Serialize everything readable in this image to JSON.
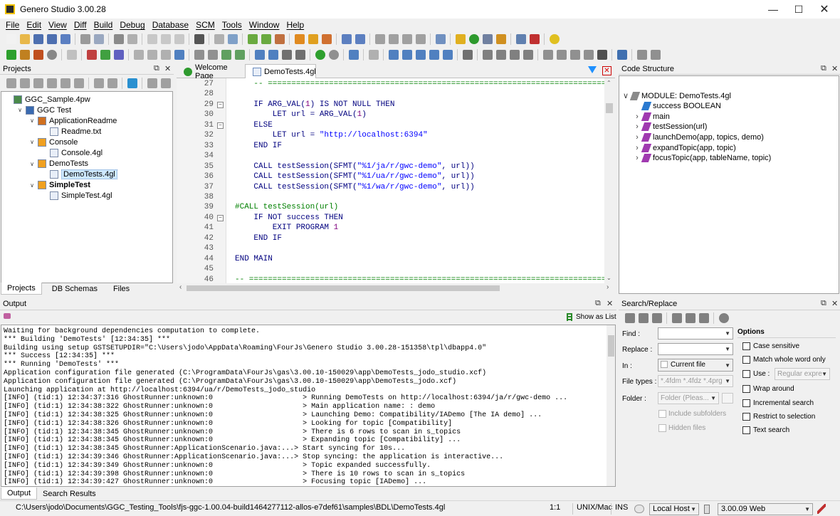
{
  "window": {
    "title": "Genero Studio 3.00.28"
  },
  "menu": [
    "File",
    "Edit",
    "View",
    "Diff",
    "Build",
    "Debug",
    "Database",
    "SCM",
    "Tools",
    "Window",
    "Help"
  ],
  "projects": {
    "title": "Projects",
    "tree": [
      {
        "label": "GGC_Sample.4pw",
        "depth": 0,
        "icon": "workspace-icon",
        "expand": ""
      },
      {
        "label": "GGC Test",
        "depth": 1,
        "icon": "project-icon",
        "expand": "v"
      },
      {
        "label": "ApplicationReadme",
        "depth": 2,
        "icon": "application-icon",
        "expand": "v"
      },
      {
        "label": "Readme.txt",
        "depth": 3,
        "icon": "text-file-icon",
        "expand": ""
      },
      {
        "label": "Console",
        "depth": 2,
        "icon": "module-group-icon",
        "expand": "v"
      },
      {
        "label": "Console.4gl",
        "depth": 3,
        "icon": "4gl-file-icon",
        "expand": ""
      },
      {
        "label": "DemoTests",
        "depth": 2,
        "icon": "module-group-icon",
        "expand": "v"
      },
      {
        "label": "DemoTests.4gl",
        "depth": 3,
        "icon": "4gl-file-icon",
        "expand": "",
        "selected": true
      },
      {
        "label": "SimpleTest",
        "depth": 2,
        "icon": "module-group-icon",
        "expand": "v",
        "bold": true
      },
      {
        "label": "SimpleTest.4gl",
        "depth": 3,
        "icon": "4gl-file-icon",
        "expand": ""
      }
    ],
    "tabs": [
      "Projects",
      "DB Schemas",
      "Files"
    ]
  },
  "editor": {
    "tabs": [
      "Welcome Page",
      "DemoTests.4gl"
    ],
    "lines": [
      {
        "n": "27",
        "html": "<span class=\"com\">    -- ============================================================================</span>"
      },
      {
        "n": "28",
        "html": ""
      },
      {
        "n": "29",
        "html": "    IF ARG_VAL(<span class=\"num\">1</span>) IS NOT NULL THEN",
        "fold": "-"
      },
      {
        "n": "30",
        "html": "        LET url = ARG_VAL(<span class=\"num\">1</span>)"
      },
      {
        "n": "31",
        "html": "    ELSE",
        "fold": "-"
      },
      {
        "n": "32",
        "html": "        LET url = <span class=\"str\">\"http://localhost:6394\"</span>"
      },
      {
        "n": "33",
        "html": "    END IF"
      },
      {
        "n": "34",
        "html": ""
      },
      {
        "n": "35",
        "html": "    CALL testSession(SFMT(<span class=\"str\">\"%1/ja/r/gwc-demo\"</span>, url))"
      },
      {
        "n": "36",
        "html": "    CALL testSession(SFMT(<span class=\"str\">\"%1/ua/r/gwc-demo\"</span>, url))"
      },
      {
        "n": "37",
        "html": "    CALL testSession(SFMT(<span class=\"str\">\"%1/wa/r/gwc-demo\"</span>, url))"
      },
      {
        "n": "38",
        "html": ""
      },
      {
        "n": "39",
        "html": "<span class=\"com\">#CALL testSession(url)</span>"
      },
      {
        "n": "40",
        "html": "    IF NOT success THEN",
        "fold": "-"
      },
      {
        "n": "41",
        "html": "        EXIT PROGRAM <span class=\"num\">1</span>"
      },
      {
        "n": "42",
        "html": "    END IF"
      },
      {
        "n": "43",
        "html": ""
      },
      {
        "n": "44",
        "html": "END MAIN"
      },
      {
        "n": "45",
        "html": ""
      },
      {
        "n": "46",
        "html": "<span class=\"com\">-- ============================================================================</span>"
      }
    ]
  },
  "code_structure": {
    "title": "Code Structure",
    "items": [
      {
        "label": "MODULE: DemoTests.4gl",
        "depth": 0,
        "expand": "v",
        "icon": "module-icon"
      },
      {
        "label": "success BOOLEAN",
        "depth": 1,
        "expand": "",
        "icon": "variable-icon"
      },
      {
        "label": "main",
        "depth": 1,
        "expand": ">",
        "icon": "function-icon"
      },
      {
        "label": "testSession(url)",
        "depth": 1,
        "expand": ">",
        "icon": "function-icon"
      },
      {
        "label": "launchDemo(app, topics, demo)",
        "depth": 1,
        "expand": ">",
        "icon": "function-icon"
      },
      {
        "label": "expandTopic(app, topic)",
        "depth": 1,
        "expand": ">",
        "icon": "function-icon"
      },
      {
        "label": "focusTopic(app, tableName, topic)",
        "depth": 1,
        "expand": ">",
        "icon": "function-icon"
      }
    ]
  },
  "output": {
    "title": "Output",
    "show_as_list": "Show as List",
    "lines": [
      "Waiting for background dependencies computation to complete.",
      "*** Building 'DemoTests' [12:34:35] ***",
      "Building using setup GSTSETUPDIR=\"C:\\Users\\jodo\\AppData\\Roaming\\FourJs\\Genero Studio 3.00.28-151358\\tpl\\dbapp4.0\"",
      "*** Success [12:34:35] ***",
      "*** Running 'DemoTests' ***",
      "Application configuration file generated (C:\\ProgramData\\FourJs\\gas\\3.00.10-150029\\app\\DemoTests_jodo_studio.xcf)",
      "Application configuration file generated (C:\\ProgramData\\FourJs\\gas\\3.00.10-150029\\app\\DemoTests_jodo.xcf)",
      "Launching application at http://localhost:6394/ua/r/DemoTests_jodo_studio",
      "[INFO] (tid:1) 12:34:37:316 GhostRunner:unknown:0                     > Running DemoTests on http://localhost:6394/ja/r/gwc-demo ...",
      "[INFO] (tid:1) 12:34:38:322 GhostRunner:unknown:0                     > Main application name: : demo",
      "[INFO] (tid:1) 12:34:38:325 GhostRunner:unknown:0                     > Launching Demo: Compatibility/IADemo [The IA demo] ...",
      "[INFO] (tid:1) 12:34:38:326 GhostRunner:unknown:0                     > Looking for topic [Compatibility]",
      "[INFO] (tid:1) 12:34:38:345 GhostRunner:unknown:0                     > There is 6 rows to scan in s_topics",
      "[INFO] (tid:1) 12:34:38:345 GhostRunner:unknown:0                     > Expanding topic [Compatibility] ...",
      "[INFO] (tid:1) 12:34:38:345 GhostRunner:ApplicationScenario.java:...> Start syncing for 10s...",
      "[INFO] (tid:1) 12:34:39:346 GhostRunner:ApplicationScenario.java:...> Stop syncing: the application is interactive...",
      "[INFO] (tid:1) 12:34:39:349 GhostRunner:unknown:0                     > Topic expanded successfully.",
      "[INFO] (tid:1) 12:34:39:398 GhostRunner:unknown:0                     > There is 10 rows to scan in s_topics",
      "[INFO] (tid:1) 12:34:39:427 GhostRunner:unknown:0                     > Focusing topic [IADemo] ..."
    ],
    "tabs": [
      "Output",
      "Search Results"
    ]
  },
  "search": {
    "title": "Search/Replace",
    "find_label": "Find :",
    "replace_label": "Replace :",
    "in_label": "In :",
    "in_value": "Current file",
    "file_types_label": "File types :",
    "file_types_value": "*.4fdm *.4fdz *.4prg",
    "folder_label": "Folder :",
    "folder_placeholder": "Folder (Pleas...",
    "include_subfolders": "Include subfolders",
    "hidden_files": "Hidden files",
    "options_title": "Options",
    "case_sensitive": "Case sensitive",
    "whole_word": "Match whole word only",
    "use": "Use :",
    "use_value": "Regular expre",
    "wrap_around": "Wrap around",
    "incremental": "Incremental search",
    "restrict": "Restrict to selection",
    "text_search": "Text search"
  },
  "status": {
    "path": "C:\\Users\\jodo\\Documents\\GGC_Testing_Tools\\fjs-ggc-1.00.04-build1464277112-allos-e7def61\\samples\\BDL\\DemoTests.4gl",
    "position": "1:1",
    "eol": "UNIX/Mac",
    "mode": "INS",
    "host": "Local Host",
    "version": "3.00.09 Web"
  },
  "colors": {
    "accent": "#1e90ff",
    "selection": "#cde8ff",
    "code_keyword": "#00007f",
    "code_string": "#0000ff",
    "code_comment": "#008000"
  }
}
